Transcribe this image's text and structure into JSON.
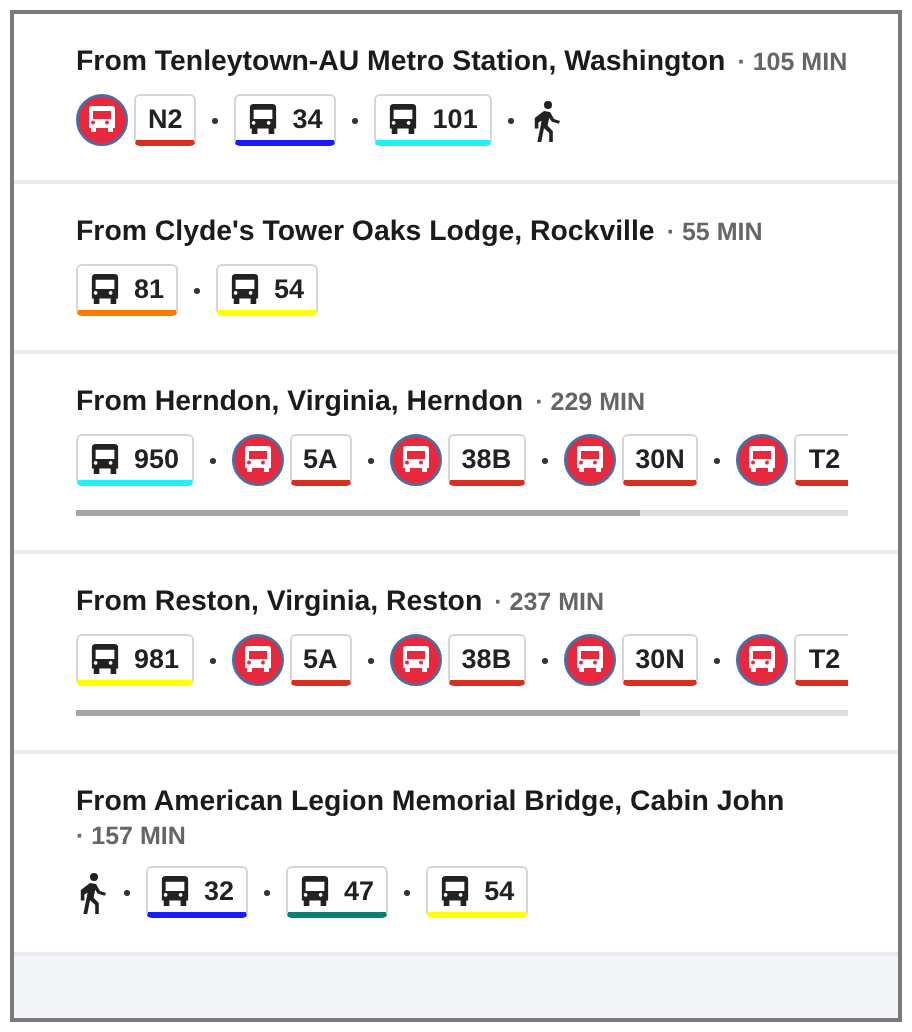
{
  "trips": [
    {
      "title": "From Tenleytown-AU Metro Station, Washington",
      "duration": "· 105 MIN",
      "scrollable": false,
      "steps": [
        {
          "kind": "metro",
          "label": "N2",
          "color": "#d7301f"
        },
        {
          "kind": "bus",
          "label": "34",
          "color": "#1a1aff"
        },
        {
          "kind": "bus",
          "label": "101",
          "color": "#22f0f8"
        },
        {
          "kind": "walk"
        }
      ]
    },
    {
      "title": "From Clyde's Tower Oaks Lodge, Rockville",
      "duration": "· 55 MIN",
      "scrollable": false,
      "steps": [
        {
          "kind": "bus",
          "label": "81",
          "color": "#ff7a00"
        },
        {
          "kind": "bus",
          "label": "54",
          "color": "#ffff00"
        }
      ]
    },
    {
      "title": "From Herndon, Virginia, Herndon",
      "duration": "· 229 MIN",
      "scrollable": true,
      "steps": [
        {
          "kind": "bus",
          "label": "950",
          "color": "#22f0f8"
        },
        {
          "kind": "metro",
          "label": "5A",
          "color": "#d7301f"
        },
        {
          "kind": "metro",
          "label": "38B",
          "color": "#d7301f"
        },
        {
          "kind": "metro",
          "label": "30N",
          "color": "#d7301f"
        },
        {
          "kind": "metro",
          "label": "T2",
          "color": "#d7301f"
        }
      ]
    },
    {
      "title": "From Reston, Virginia, Reston",
      "duration": "· 237 MIN",
      "scrollable": true,
      "steps": [
        {
          "kind": "bus",
          "label": "981",
          "color": "#ffff00"
        },
        {
          "kind": "metro",
          "label": "5A",
          "color": "#d7301f"
        },
        {
          "kind": "metro",
          "label": "38B",
          "color": "#d7301f"
        },
        {
          "kind": "metro",
          "label": "30N",
          "color": "#d7301f"
        },
        {
          "kind": "metro",
          "label": "T2",
          "color": "#d7301f"
        }
      ]
    },
    {
      "title": "From American Legion Memorial Bridge, Cabin John",
      "duration": "· 157 MIN",
      "scrollable": false,
      "steps": [
        {
          "kind": "walk"
        },
        {
          "kind": "bus",
          "label": "32",
          "color": "#1a1aff"
        },
        {
          "kind": "bus",
          "label": "47",
          "color": "#0a7f72"
        },
        {
          "kind": "bus",
          "label": "54",
          "color": "#ffff00"
        }
      ]
    }
  ]
}
